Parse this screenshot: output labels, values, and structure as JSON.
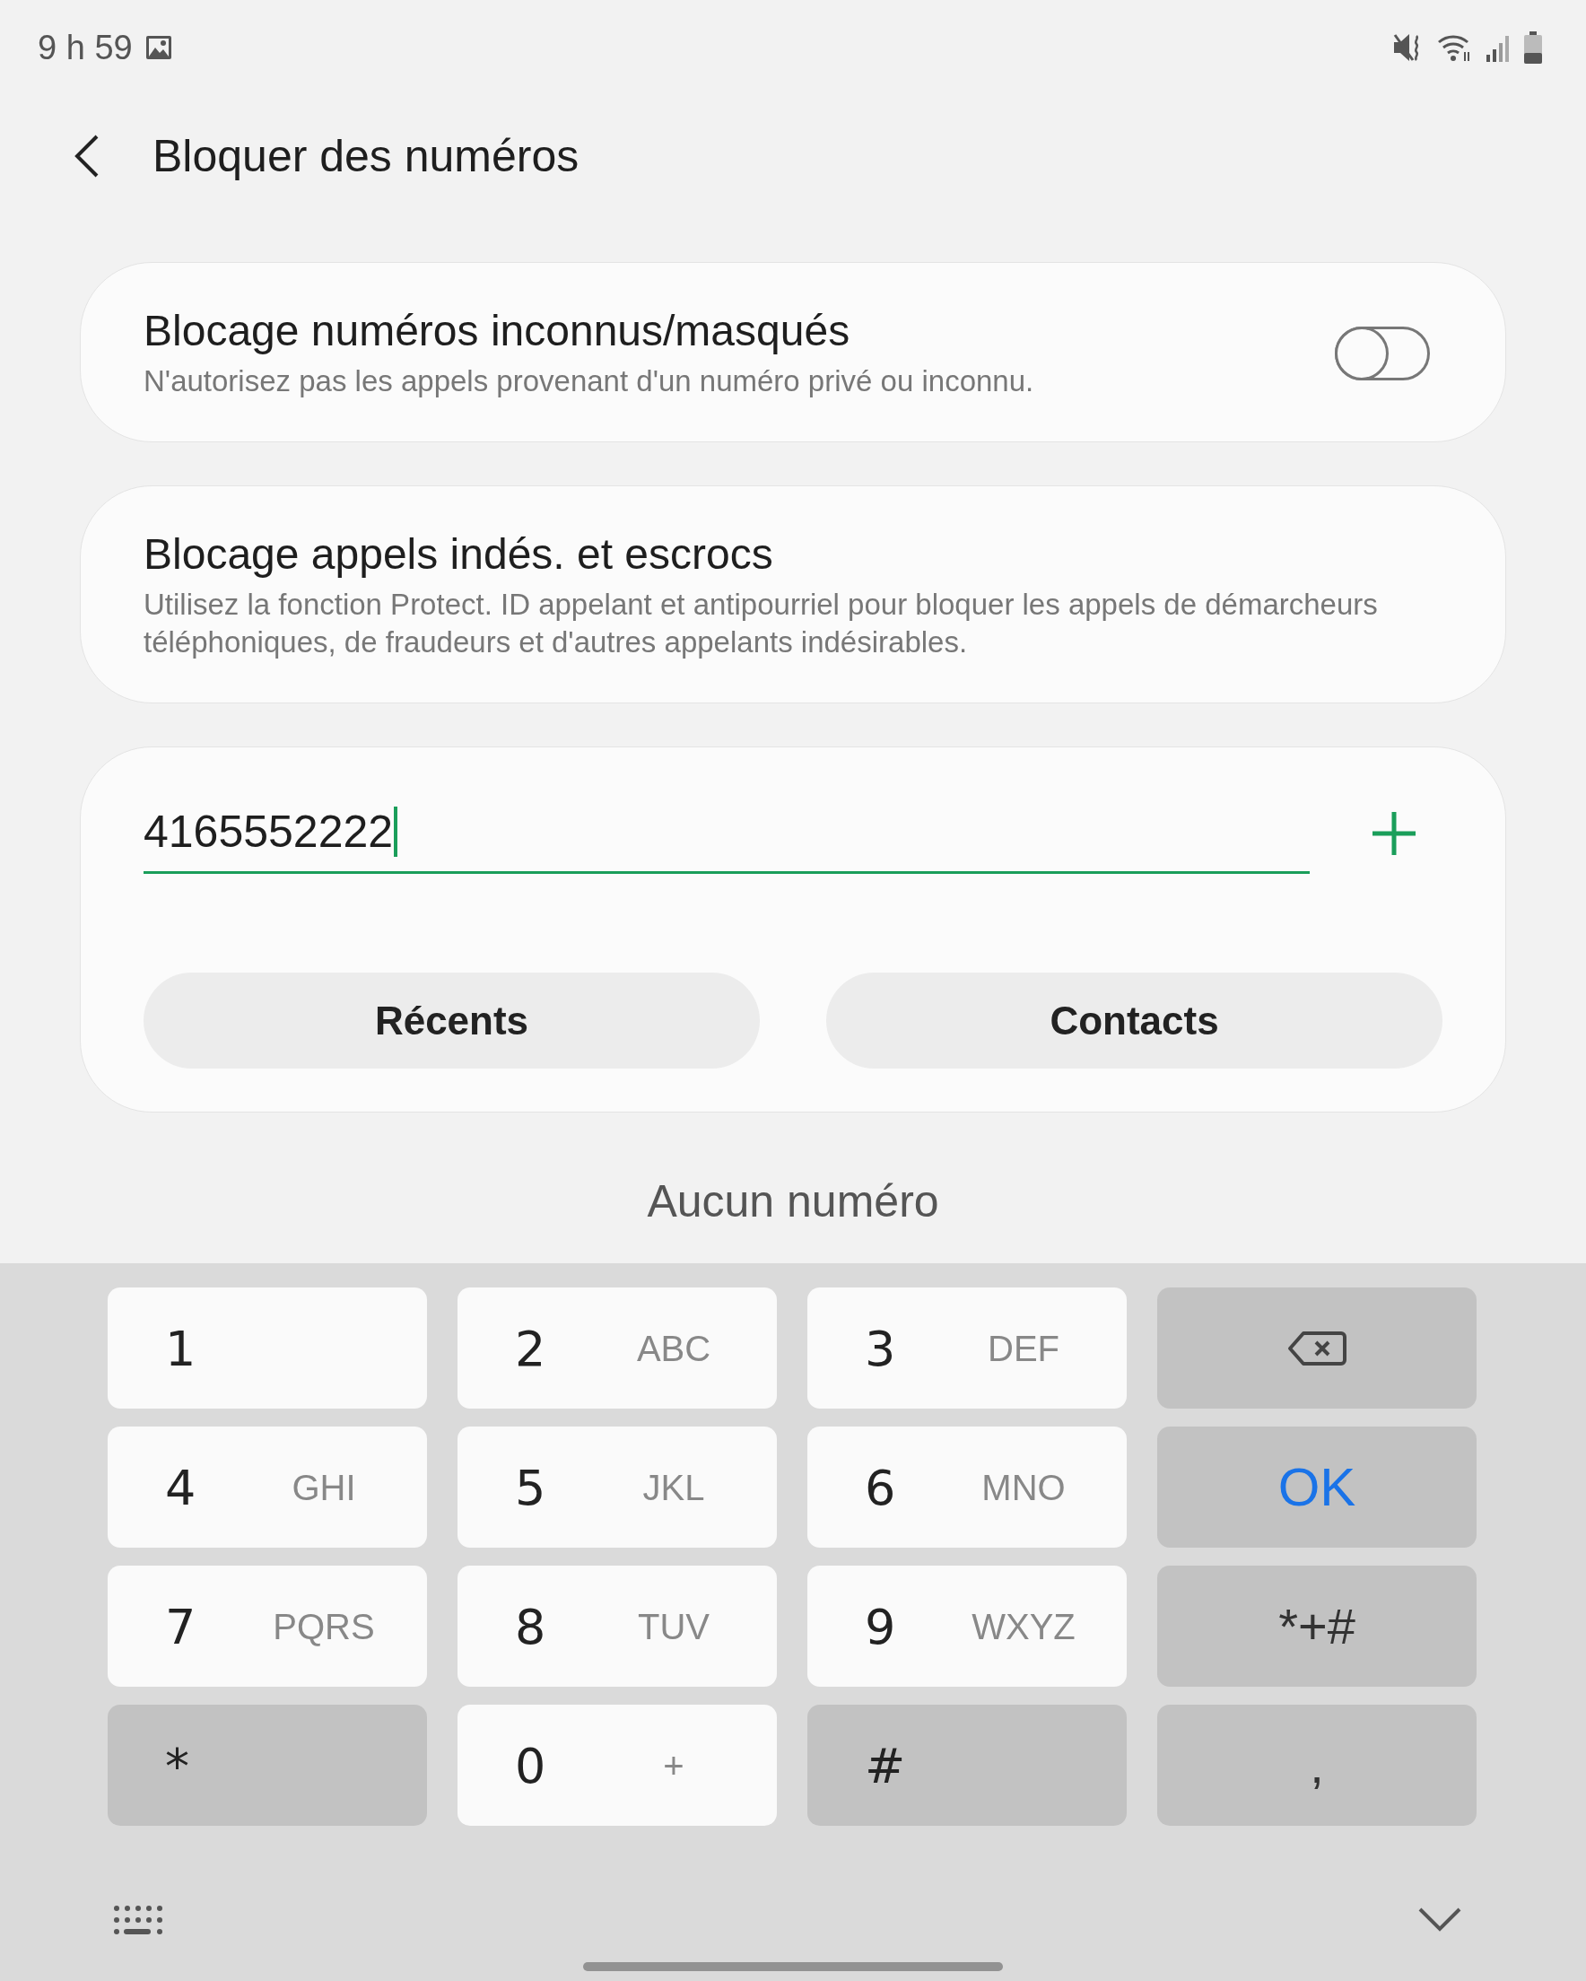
{
  "status_bar": {
    "time": "9 h 59"
  },
  "header": {
    "title": "Bloquer des numéros"
  },
  "settings": [
    {
      "title": "Blocage numéros inconnus/masqués",
      "description": "N'autorisez pas les appels provenant d'un numéro privé ou inconnu.",
      "kind": "toggle",
      "on": false
    },
    {
      "title": "Blocage appels indés. et escrocs",
      "description": "Utilisez la fonction Protect. ID appelant et antipourriel pour bloquer les appels de démarcheurs téléphoniques, de fraudeurs et d'autres appelants indésirables.",
      "kind": "link"
    }
  ],
  "number_entry": {
    "value": "4165552222",
    "focused": true,
    "buttons": [
      "Récents",
      "Contacts"
    ]
  },
  "empty_message": "Aucun numéro",
  "keypad": {
    "keys": [
      {
        "kind": "digit",
        "main": "1"
      },
      {
        "kind": "digit",
        "main": "2",
        "letters": "ABC"
      },
      {
        "kind": "digit",
        "main": "3",
        "letters": "DEF"
      },
      {
        "kind": "backspace"
      },
      {
        "kind": "digit",
        "main": "4",
        "letters": "GHI"
      },
      {
        "kind": "digit",
        "main": "5",
        "letters": "JKL"
      },
      {
        "kind": "digit",
        "main": "6",
        "letters": "MNO"
      },
      {
        "kind": "ok",
        "main": "OK"
      },
      {
        "kind": "digit",
        "main": "7",
        "letters": "PQRS"
      },
      {
        "kind": "digit",
        "main": "8",
        "letters": "TUV"
      },
      {
        "kind": "digit",
        "main": "9",
        "letters": "WXYZ"
      },
      {
        "kind": "function",
        "main": "*+#"
      },
      {
        "kind": "symbol",
        "main": "*"
      },
      {
        "kind": "digit",
        "main": "0",
        "letters": "+"
      },
      {
        "kind": "symbol",
        "main": "#"
      },
      {
        "kind": "function",
        "main": ","
      }
    ]
  }
}
